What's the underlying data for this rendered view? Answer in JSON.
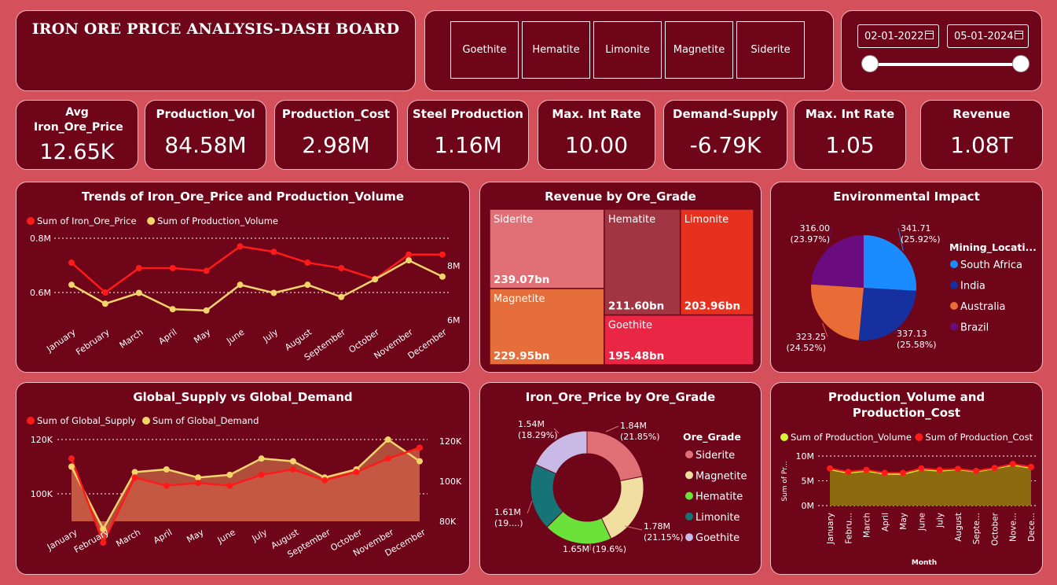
{
  "header": {
    "title": "IRON ORE PRICE ANALYSIS-DASH BOARD"
  },
  "slicer": {
    "options": [
      "Goethite",
      "Hematite",
      "Limonite",
      "Magnetite",
      "Siderite"
    ]
  },
  "date_range": {
    "start": "02-01-2022",
    "end": "05-01-2024"
  },
  "kpis": [
    {
      "label": "Avg Iron_Ore_Price",
      "value": "12.65K"
    },
    {
      "label": "Production_Vol",
      "value": "84.58M"
    },
    {
      "label": "Production_Cost",
      "value": "2.98M"
    },
    {
      "label": "Steel Production",
      "value": "1.16M"
    },
    {
      "label": "Max. Int Rate",
      "value": "10.00"
    },
    {
      "label": "Demand-Supply",
      "value": "-6.79K"
    },
    {
      "label": "Max. Int Rate",
      "value": "1.05"
    },
    {
      "label": "Revenue",
      "value": "1.08T"
    }
  ],
  "colors": {
    "panel": "#6e0519",
    "background": "#d4505a",
    "red": "#ff1a1a",
    "yellow": "#f2d46b",
    "area": "#c85a44"
  },
  "chart_data": [
    {
      "type": "line",
      "title": "Trends of Iron_Ore_Price and Production_Volume",
      "categories": [
        "January",
        "February",
        "March",
        "April",
        "May",
        "June",
        "July",
        "August",
        "September",
        "October",
        "November",
        "December"
      ],
      "series": [
        {
          "name": "Sum of Iron_Ore_Price",
          "axis": "left",
          "values": [
            0.71,
            0.6,
            0.69,
            0.69,
            0.68,
            0.77,
            0.75,
            0.71,
            0.69,
            0.65,
            0.74,
            0.74
          ]
        },
        {
          "name": "Sum of Production_Volume",
          "axis": "right",
          "values": [
            7.3,
            6.6,
            7.0,
            6.4,
            6.35,
            7.3,
            7.0,
            7.3,
            6.85,
            7.5,
            8.2,
            7.6
          ]
        }
      ],
      "yticks_left": [
        "0.6M",
        "0.8M"
      ],
      "ylim_left": [
        0.5,
        0.8
      ],
      "yticks_right": [
        "6M",
        "8M"
      ],
      "ylim_right": [
        5.5,
        8.6
      ],
      "legend": "top-left"
    },
    {
      "type": "treemap",
      "title": "Revenue by Ore_Grade",
      "items": [
        {
          "label": "Siderite",
          "value": 239.07,
          "display": "239.07bn",
          "color": "#e07076"
        },
        {
          "label": "Magnetite",
          "value": 229.95,
          "display": "229.95bn",
          "color": "#e56e3a"
        },
        {
          "label": "Hematite",
          "value": 211.6,
          "display": "211.60bn",
          "color": "#a23542"
        },
        {
          "label": "Limonite",
          "value": 203.96,
          "display": "203.96bn",
          "color": "#e8301f"
        },
        {
          "label": "Goethite",
          "value": 195.48,
          "display": "195.48bn",
          "color": "#ea2645"
        }
      ]
    },
    {
      "type": "pie",
      "title": "Environmental Impact",
      "legend_title": "Mining_Locati...",
      "slices": [
        {
          "name": "South Africa",
          "value": 341.71,
          "label": "341.71",
          "pct": "(25.92%)",
          "color": "#1a8cff"
        },
        {
          "name": "India",
          "value": 337.13,
          "label": "337.13",
          "pct": "(25.58%)",
          "color": "#1730a0"
        },
        {
          "name": "Australia",
          "value": 323.25,
          "label": "323.25",
          "pct": "(24.52%)",
          "color": "#e96b35"
        },
        {
          "name": "Brazil",
          "value": 316.0,
          "label": "316.00",
          "pct": "(23.97%)",
          "color": "#6a0c80"
        }
      ]
    },
    {
      "type": "area",
      "title": "Global_Supply vs Global_Demand",
      "categories": [
        "January",
        "February",
        "March",
        "April",
        "May",
        "June",
        "July",
        "August",
        "September",
        "October",
        "November",
        "December"
      ],
      "series": [
        {
          "name": "Sum of Global_Supply",
          "axis": "left",
          "values": [
            113000,
            82000,
            106000,
            103000,
            104000,
            103000,
            107000,
            109000,
            105000,
            108000,
            113000,
            117000
          ]
        },
        {
          "name": "Sum of Global_Demand",
          "axis": "right",
          "values": [
            110000,
            87000,
            108000,
            109000,
            106000,
            107000,
            113000,
            112000,
            106000,
            109000,
            120000,
            112000
          ]
        }
      ],
      "yticks_left": [
        "100K",
        "120K"
      ],
      "ylim_left": [
        78000,
        125000
      ],
      "yticks_right": [
        "80K",
        "100K",
        "120K"
      ],
      "ylim_right": [
        78000,
        125000
      ],
      "legend": "top-left"
    },
    {
      "type": "donut",
      "title": "Iron_Ore_Price by Ore_Grade",
      "legend_title": "Ore_Grade",
      "slices": [
        {
          "name": "Siderite",
          "value": 1.84,
          "label": "1.84M",
          "pct": "(21.85%)",
          "color": "#e07076"
        },
        {
          "name": "Magnetite",
          "value": 1.78,
          "label": "1.78M",
          "pct": "(21.15%)",
          "color": "#f0dfa0"
        },
        {
          "name": "Hematite",
          "value": 1.65,
          "label": "1.65M (19.6%)",
          "pct": "",
          "color": "#6be23a"
        },
        {
          "name": "Limonite",
          "value": 1.61,
          "label": "1.61M",
          "pct": "(19....)",
          "color": "#167476"
        },
        {
          "name": "Goethite",
          "value": 1.54,
          "label": "1.54M",
          "pct": "(18.29%)",
          "color": "#c9b9e6"
        }
      ]
    },
    {
      "type": "area",
      "title": "Production_Volume and Production_Cost",
      "xlabel": "Month",
      "ylabel": "Sum of Pr...",
      "categories": [
        "January",
        "Febru...",
        "March",
        "April",
        "May",
        "June",
        "July",
        "August",
        "Septe...",
        "October",
        "Nove...",
        "Dece..."
      ],
      "series": [
        {
          "name": "Sum of Production_Volume",
          "values": [
            7.3,
            6.6,
            7.0,
            6.4,
            6.35,
            7.3,
            7.0,
            7.3,
            6.85,
            7.5,
            8.2,
            7.6
          ]
        },
        {
          "name": "Sum of Production_Cost",
          "values": [
            7.5,
            6.8,
            7.2,
            6.6,
            6.6,
            7.5,
            7.2,
            7.4,
            7.0,
            7.6,
            8.4,
            7.8
          ]
        }
      ],
      "yticks": [
        "0M",
        "5M",
        "10M"
      ],
      "ylim": [
        0,
        10
      ],
      "legend": "top-left"
    }
  ]
}
